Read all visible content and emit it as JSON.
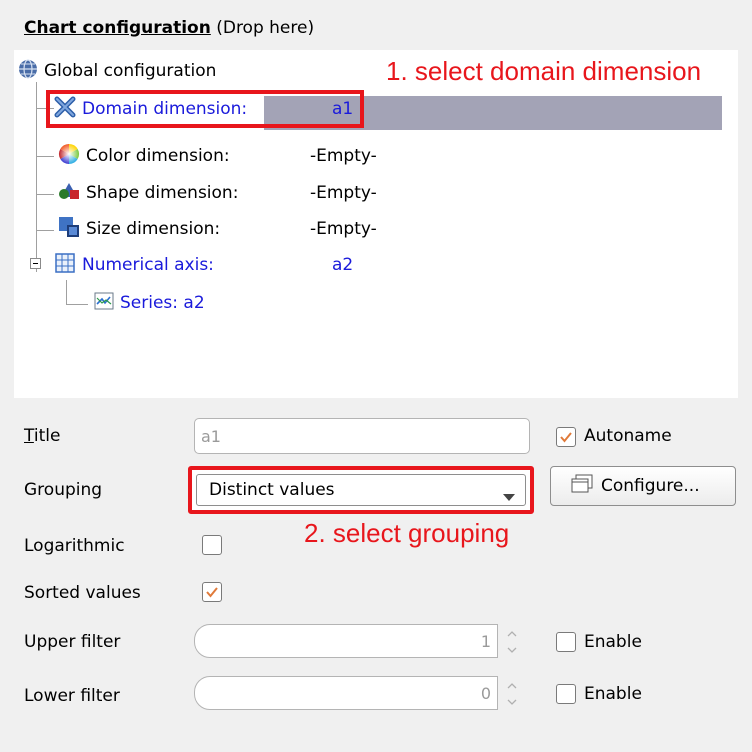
{
  "header": {
    "title_prefix": "Chart configuration",
    "title_suffix": "(Drop here)"
  },
  "tree": {
    "root": {
      "label": "Global configuration",
      "icon": "globe-icon"
    },
    "nodes": [
      {
        "label": "Domain dimension:",
        "value": "a1",
        "icon": "domain-dimension-icon",
        "selected": true
      },
      {
        "label": "Color dimension:",
        "value": "-Empty-",
        "icon": "color-wheel-icon"
      },
      {
        "label": "Shape dimension:",
        "value": "-Empty-",
        "icon": "shapes-icon"
      },
      {
        "label": "Size dimension:",
        "value": "-Empty-",
        "icon": "size-icon"
      },
      {
        "label": "Numerical axis:",
        "value": "a2",
        "icon": "grid-axis-icon",
        "expanded": true
      },
      {
        "label": "Series: a2",
        "icon": "series-chart-icon"
      }
    ]
  },
  "annotations": {
    "step1": "1. select domain dimension",
    "step2": "2. select grouping",
    "color": "#e8161c"
  },
  "form": {
    "title_label": "Title",
    "title_value": "a1",
    "autoname_label": "Autoname",
    "autoname_checked": true,
    "grouping_label": "Grouping",
    "grouping_value": "Distinct values",
    "configure_label": "Configure...",
    "logarithmic_label": "Logarithmic",
    "logarithmic_checked": false,
    "sorted_label": "Sorted values",
    "sorted_checked": true,
    "upper_filter_label": "Upper filter",
    "upper_filter_value": "1",
    "upper_enable_label": "Enable",
    "lower_filter_label": "Lower filter",
    "lower_filter_value": "0",
    "lower_enable_label": "Enable"
  },
  "colors": {
    "selection": "#a3a3b6",
    "link_blue": "#1a1adb",
    "check_orange": "#e07a3a"
  }
}
